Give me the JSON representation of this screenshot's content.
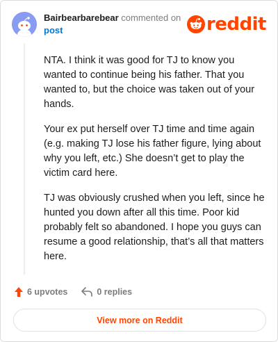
{
  "header": {
    "author": "Bairbearbarebear",
    "action": "commented on",
    "post_link": "post",
    "logo_text": "reddit"
  },
  "comment": {
    "paragraphs": [
      "NTA. I think it was good for TJ to know you wanted to continue being his father. That you wanted to, but the choice was taken out of your hands.",
      "Your ex put herself over TJ time and time again (e.g. making TJ lose his father figure, lying about why you left, etc.) She doesn’t get to play the victim card here.",
      "TJ was obviously crushed when you left, since he hunted you down after all this time. Poor kid probably felt so abandoned. I hope you guys can resume a good relationship, that’s all that matters here."
    ]
  },
  "footer": {
    "upvotes_label": "6 upvotes",
    "replies_label": "0 replies"
  },
  "view_more_label": "View more on Reddit",
  "colors": {
    "brand": "#ff4500",
    "link": "#0079d3",
    "avatar_bg": "#8a9cf2"
  },
  "icons": {
    "avatar": "snoo-avatar-icon",
    "logo": "reddit-snoo-icon",
    "upvote": "upvote-arrow-icon",
    "reply": "reply-arrow-icon"
  }
}
